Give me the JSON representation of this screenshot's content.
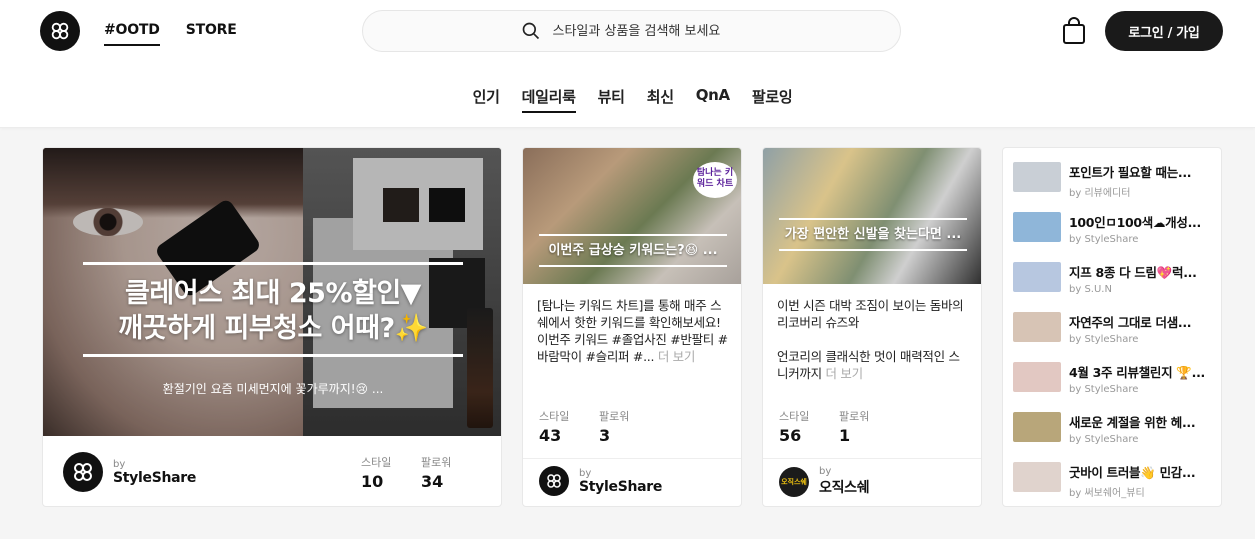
{
  "header": {
    "nav": [
      "#OOTD",
      "STORE"
    ],
    "search_placeholder": "스타일과 상품을 검색해 보세요",
    "login_label": "로그인 / 가입"
  },
  "tabs": [
    "인기",
    "데일리룩",
    "뷰티",
    "최신",
    "QnA",
    "팔로잉"
  ],
  "active_tab": "데일리룩",
  "main_card": {
    "title_line1": "클레어스 최대 25%할인▼",
    "title_line2": "깨끗하게 피부청소 어때?✨",
    "subtitle": "환절기인 요즘 미세먼지에 꽃가루까지!😢 ...",
    "by": "by",
    "author": "StyleShare",
    "style_label": "스타일",
    "style_count": "10",
    "follower_label": "팔로워",
    "follower_count": "34"
  },
  "card2": {
    "badge": "탐나는 키워드 차트",
    "caption": "이번주 급상승 키워드는?😆 ...",
    "description": "[탐나는 키워드 차트]를 통해 매주 스쉐에서 핫한 키워드를 확인해보세요! 이번주 키워드 #졸업사진 #반팔티 #바람막이 #슬리퍼 #...",
    "more": "더 보기",
    "style_label": "스타일",
    "style_count": "43",
    "follower_label": "팔로워",
    "follower_count": "3",
    "by": "by",
    "author": "StyleShare"
  },
  "card3": {
    "caption": "가장 편안한 신발을 찾는다면 ...",
    "description_line1": "이번 시즌 대박 조짐이 보이는 돔바의 리코버리 슈즈와",
    "description_line2": "언코리의 클래식한 멋이 매력적인 스니커까지",
    "more": "더 보기",
    "style_label": "스타일",
    "style_count": "56",
    "follower_label": "팔로워",
    "follower_count": "1",
    "by": "by",
    "author": "오직스쉐",
    "avatar_text": "오직스쉐"
  },
  "list": [
    {
      "title": "포인트가 필요할 때는...",
      "author": "by 리뷰에디터",
      "color": "#c9cfd6"
    },
    {
      "title": "100인ㅁ100색☁개성...",
      "author": "by StyleShare",
      "color": "#8fb6d9"
    },
    {
      "title": "지프 8종 다 드림💖럭...",
      "author": "by S.U.N",
      "color": "#b7c7e0"
    },
    {
      "title": "자연주의 그대로 더샘...",
      "author": "by StyleShare",
      "color": "#d7c4b5"
    },
    {
      "title": "4월 3주 리뷰챌린지 🏆...",
      "author": "by StyleShare",
      "color": "#e2c8c2"
    },
    {
      "title": "새로운 계절을 위한 헤...",
      "author": "by StyleShare",
      "color": "#b8a67a"
    },
    {
      "title": "굿바이 트러블👋 민감...",
      "author": "by 써보쉐어_뷰티",
      "color": "#e0d3cd"
    }
  ]
}
